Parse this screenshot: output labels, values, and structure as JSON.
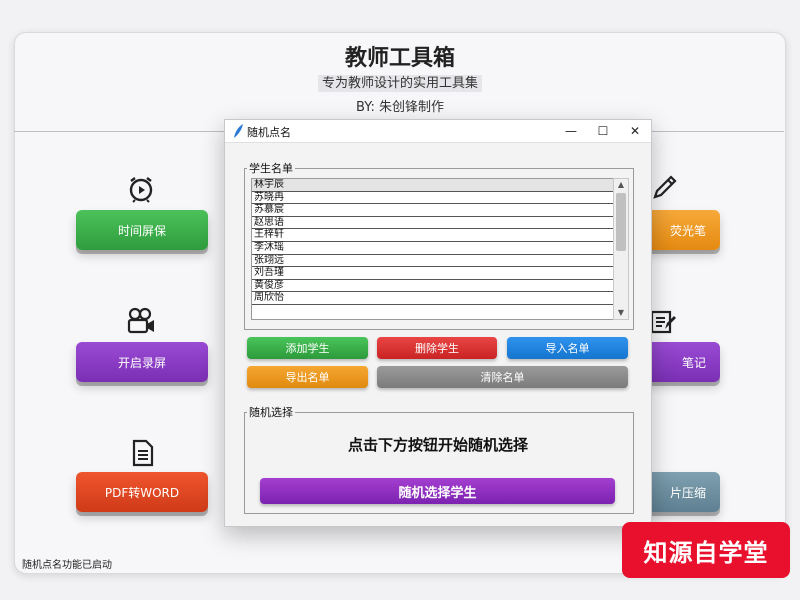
{
  "app": {
    "title": "教师工具箱",
    "subtitle": "专为教师设计的实用工具集",
    "author": "BY: 朱创锋制作",
    "status": "随机点名功能已启动"
  },
  "tools": [
    {
      "label": "时间屏保",
      "icon": "alarm-clock-icon",
      "color": "#3fae4d"
    },
    {
      "label": "开启录屏",
      "icon": "video-camera-icon",
      "color": "#8a3dc4"
    },
    {
      "label": "PDF转WORD",
      "icon": "document-icon",
      "color": "#e0441f"
    },
    {
      "label": "荧光笔",
      "partial": "荧光笔",
      "icon": "pen-icon",
      "color": "#ee9a22"
    },
    {
      "label": "笔记",
      "icon": "notepad-icon",
      "color": "#8a3dc4"
    },
    {
      "label": "片压缩",
      "icon": "compress-icon",
      "color": "#6e90a2"
    }
  ],
  "dialog": {
    "title": "随机点名",
    "controls": {
      "minimize": "—",
      "maximize": "☐",
      "close": "✕"
    },
    "student_list_label": "学生名单",
    "students": [
      "林宇辰",
      "苏晓冉",
      "苏慕宸",
      "赵思语",
      "王梓轩",
      "李沐瑶",
      "张翊远",
      "刘吾瑾",
      "黄俊彦",
      "周欣怡"
    ],
    "selected_index": 0,
    "buttons": {
      "add": "添加学生",
      "delete": "删除学生",
      "import": "导入名单",
      "export": "导出名单",
      "clear": "清除名单"
    },
    "random_group_label": "随机选择",
    "prompt": "点击下方按钮开始随机选择",
    "random_button": "随机选择学生"
  },
  "watermark": "知源自学堂"
}
